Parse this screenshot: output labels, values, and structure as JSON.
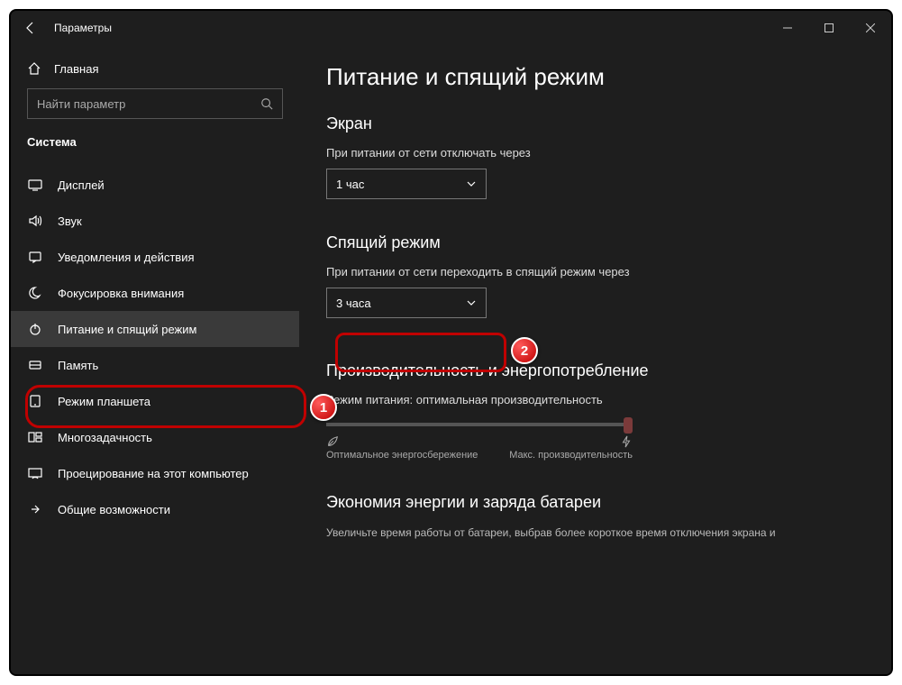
{
  "window": {
    "title": "Параметры"
  },
  "sidebar": {
    "home": "Главная",
    "search_placeholder": "Найти параметр",
    "category": "Система",
    "items": [
      {
        "label": "Дисплей"
      },
      {
        "label": "Звук"
      },
      {
        "label": "Уведомления и действия"
      },
      {
        "label": "Фокусировка внимания"
      },
      {
        "label": "Питание и спящий режим"
      },
      {
        "label": "Память"
      },
      {
        "label": "Режим планшета"
      },
      {
        "label": "Многозадачность"
      },
      {
        "label": "Проецирование на этот компьютер"
      },
      {
        "label": "Общие возможности"
      }
    ]
  },
  "main": {
    "title": "Питание и спящий режим",
    "screen": {
      "heading": "Экран",
      "label": "При питании от сети отключать через",
      "value": "1 час"
    },
    "sleep": {
      "heading": "Спящий режим",
      "label": "При питании от сети переходить в спящий режим через",
      "value": "3 часа"
    },
    "perf": {
      "heading": "Производительность и энергопотребление",
      "mode": "Режим питания: оптимальная производительность",
      "left": "Оптимальное энергосбережение",
      "right": "Макс. производительность"
    },
    "economy": {
      "heading": "Экономия энергии и заряда батареи",
      "text": "Увеличьте время работы от батареи, выбрав более короткое время отключения экрана и"
    }
  },
  "markers": {
    "one": "1",
    "two": "2"
  }
}
